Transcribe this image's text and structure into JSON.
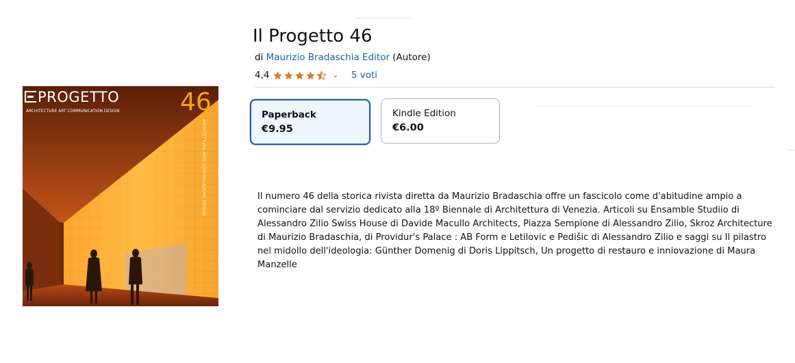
{
  "product": {
    "title": "Il Progetto 46",
    "byline_prefix": "di",
    "author": "Maurizio Bradaschia Editor",
    "author_role": "(Autore)",
    "rating_value": "4,4",
    "rating_stars": 4.5,
    "votes_label": "5 voti"
  },
  "cover": {
    "logo_text": "PROGETTO",
    "tagline": "ARCHITECTURE ART COMMUNICATION DESIGN",
    "issue_number": "46",
    "side_text": "ARCHITETTURA ARTE COMUNICAZIONE DESIGN"
  },
  "formats": [
    {
      "label": "Paperback",
      "price": "€9.95",
      "selected": true
    },
    {
      "label": "Kindle Edition",
      "price": "€6.00",
      "selected": false
    }
  ],
  "description": "Il numero 46 della storica rivista diretta da Maurizio Bradaschia offre un fascicolo come d'abitudine ampio a cominciare dal servizio dedicato alla 18º Biennale di Architettura di Venezia. Articoli su Ensamble Studiio di Alessandro Zilio Swiss House di Davide Macullo Architects, Piazza Sempione di Alessandro Zilio, Skroz Architecture di Maurizio Bradaschia, di Providur's Palace : AB Form e Letilovic e Pedišic di Alessandro Zilio e saggi su Il pilastro nel midollo dell'ideologia: Günther Domenig di Doris Lippitsch, Un progetto di restauro e inniovazione di Maura Manzelle",
  "colors": {
    "link": "#2162a1",
    "star": "#de7921",
    "selected_border": "#2a5b9c",
    "selected_bg": "#edf7fd"
  },
  "icons": {
    "rating_dropdown": "chevron-down-icon",
    "star": "star-icon"
  }
}
